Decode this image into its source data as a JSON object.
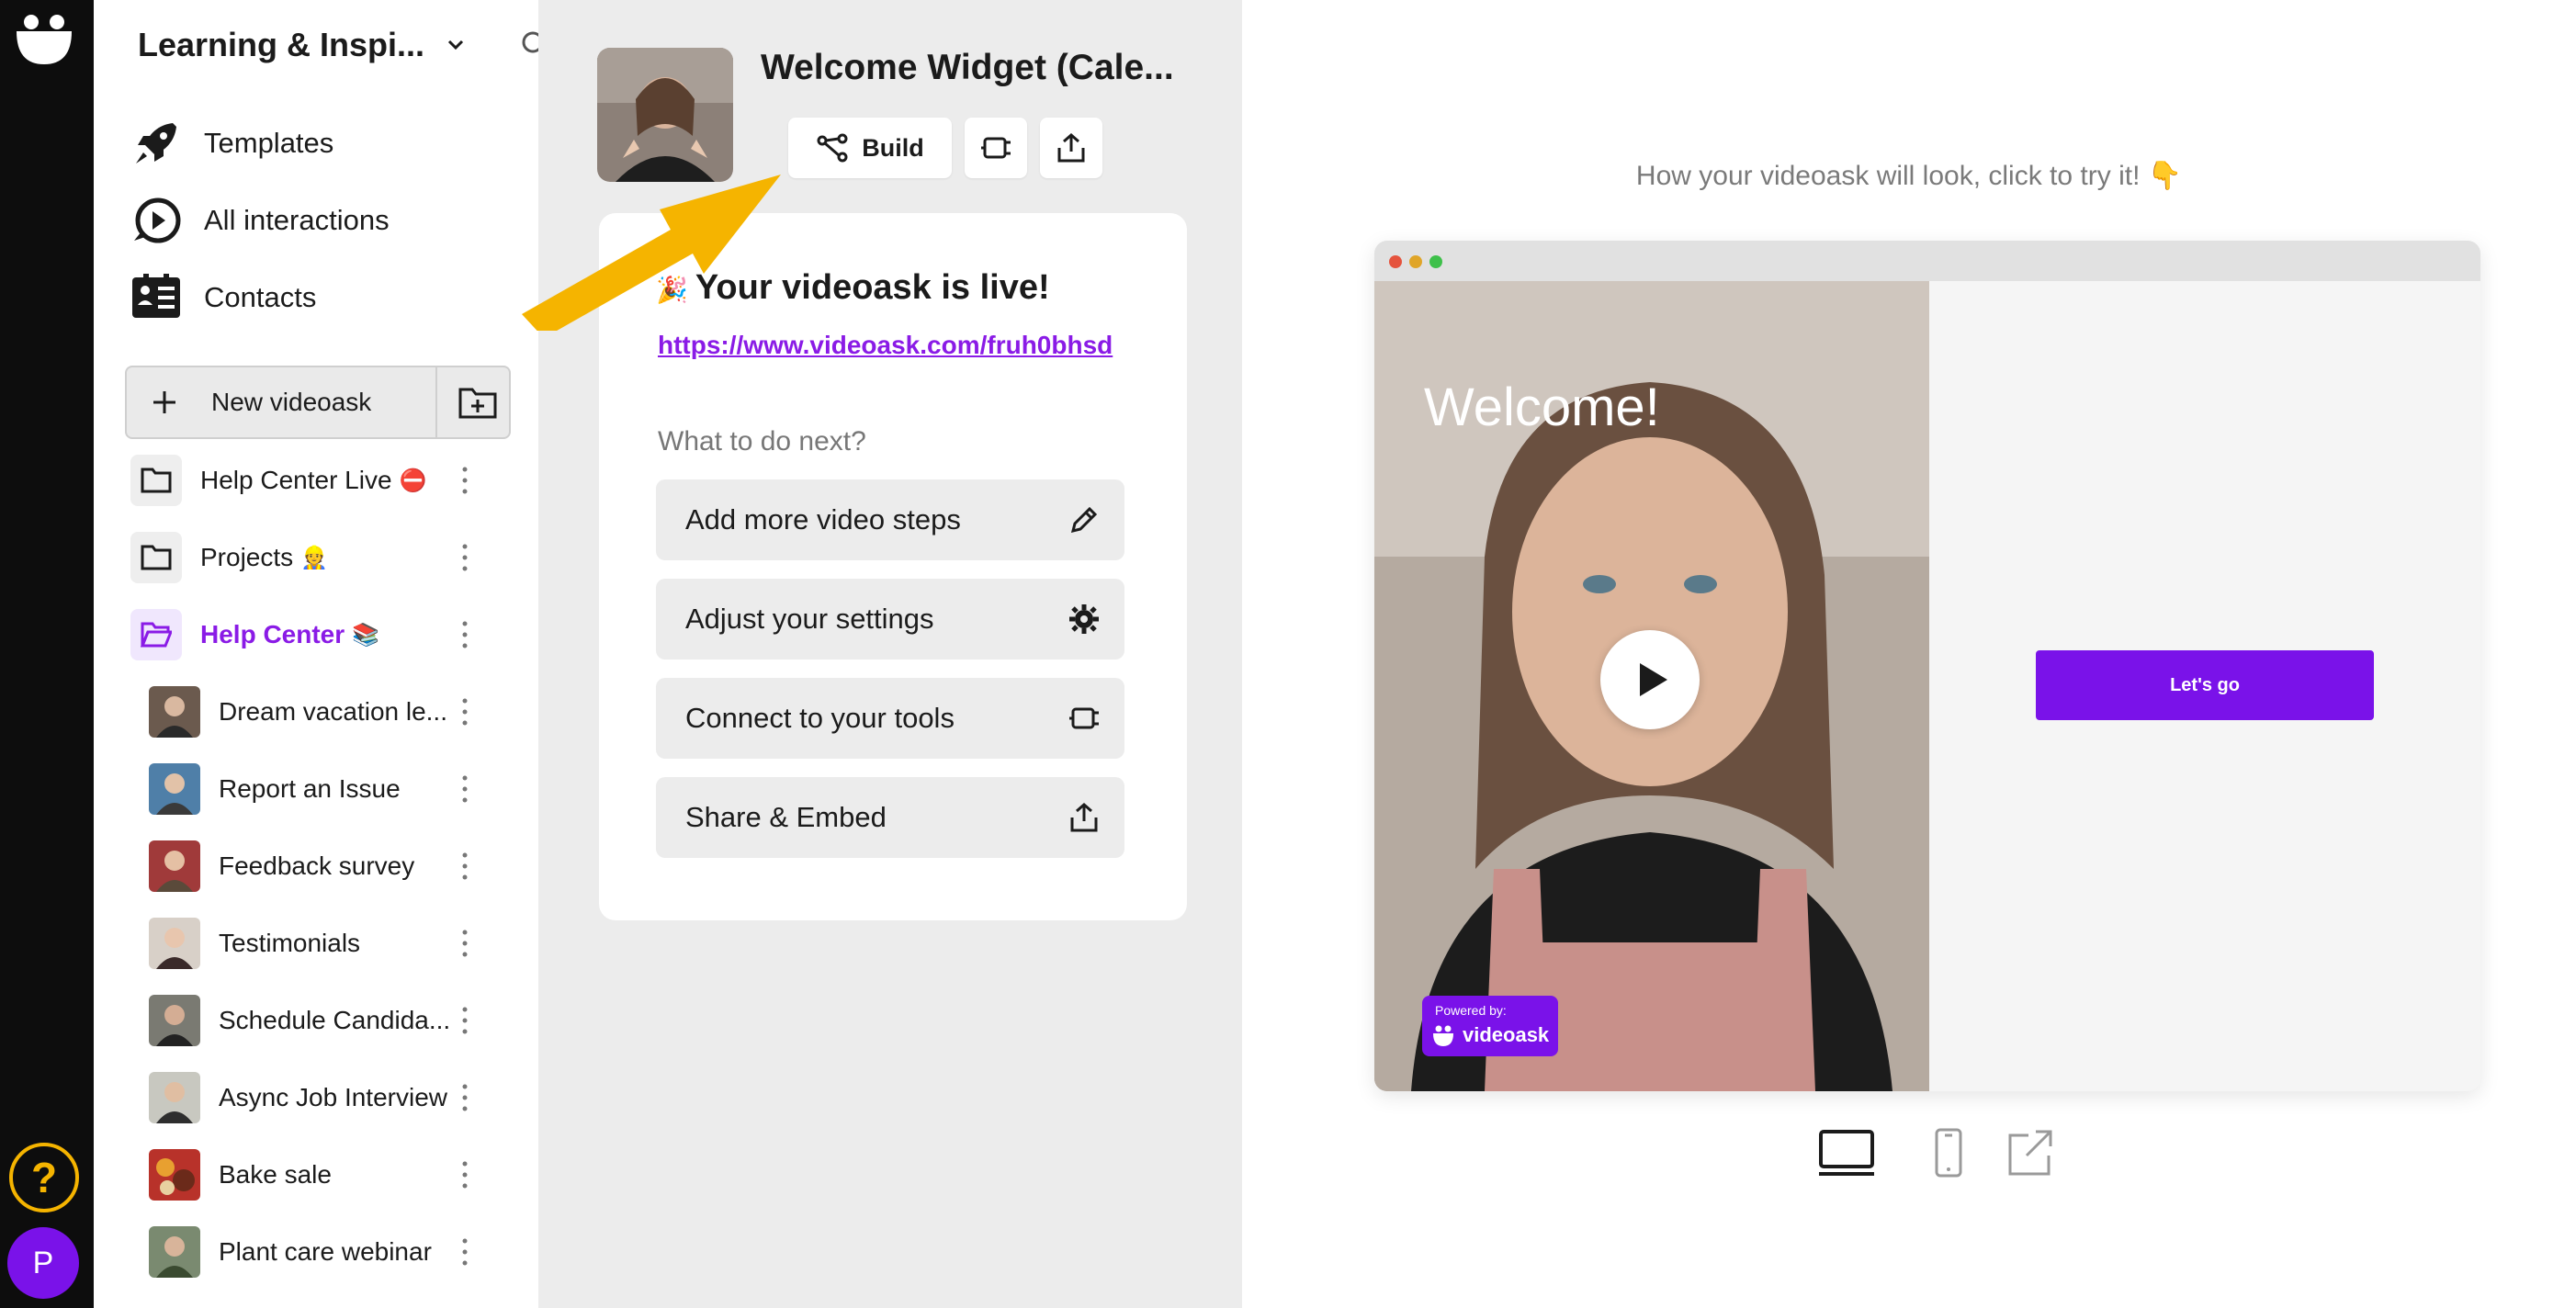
{
  "sidebar": {
    "workspace_title": "Learning & Inspi...",
    "nav": [
      {
        "label": "Templates",
        "icon": "rocket-icon"
      },
      {
        "label": "All interactions",
        "icon": "play-bubble-icon"
      },
      {
        "label": "Contacts",
        "icon": "contacts-icon"
      }
    ],
    "new_button_label": "New videoask",
    "folders": [
      {
        "label": "Help Center Live",
        "emoji": "⛔"
      },
      {
        "label": "Projects",
        "emoji": "👷"
      },
      {
        "label": "Help Center",
        "emoji": "📚"
      }
    ],
    "items": [
      {
        "label": "Dream vacation le..."
      },
      {
        "label": "Report an Issue"
      },
      {
        "label": "Feedback survey"
      },
      {
        "label": "Testimonials"
      },
      {
        "label": "Schedule Candida..."
      },
      {
        "label": "Async Job Interview"
      },
      {
        "label": "Bake sale"
      },
      {
        "label": "Plant care webinar"
      }
    ]
  },
  "rail": {
    "help_label": "?",
    "avatar_initial": "P"
  },
  "middle": {
    "title": "Welcome Widget (Cale...",
    "build_label": "Build",
    "live_emoji": "🎉",
    "live_title": "Your videoask is live!",
    "live_link": "https://www.videoask.com/fruh0bhsd",
    "next_label": "What to do next?",
    "actions": [
      {
        "label": "Add more video steps",
        "icon": "pencil-icon"
      },
      {
        "label": "Adjust your settings",
        "icon": "gear-icon"
      },
      {
        "label": "Connect to your tools",
        "icon": "plug-icon"
      },
      {
        "label": "Share & Embed",
        "icon": "share-icon"
      }
    ]
  },
  "preview": {
    "caption": "How your videoask will look, click to try it! 👇",
    "welcome_text": "Welcome!",
    "powered_small": "Powered by:",
    "powered_brand": "videoask",
    "cta_label": "Let's go"
  },
  "colors": {
    "accent": "#7a12e9",
    "arrow": "#f5b400",
    "rail": "#0d0d0d"
  }
}
